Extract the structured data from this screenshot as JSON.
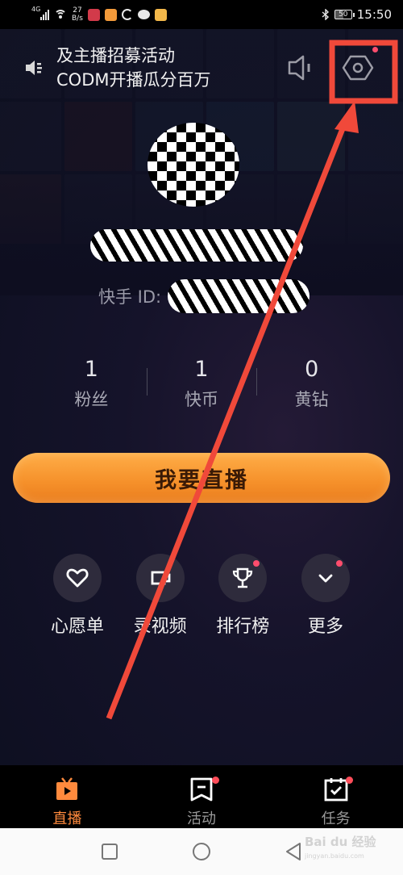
{
  "status_bar": {
    "network": "4G",
    "speed_value": "27",
    "speed_unit": "B/s",
    "battery": "50",
    "time": "15:50",
    "icons": [
      "signal-icon",
      "wifi-icon",
      "app-notification-icon",
      "app-notification-icon",
      "sync-icon",
      "chat-icon",
      "app-notification-icon",
      "bluetooth-icon",
      "battery-icon"
    ]
  },
  "header": {
    "announcement_line1": "及主播招募活动",
    "announcement_line2": "CODM开播瓜分百万",
    "announcement_icon": "speaker-icon",
    "sound_icon": "sound-toggle-icon",
    "settings_icon": "settings-hexagon-icon"
  },
  "profile": {
    "username": "",
    "id_label": "快手 ID:",
    "id_value": ""
  },
  "stats": [
    {
      "value": "1",
      "label": "粉丝"
    },
    {
      "value": "1",
      "label": "快币"
    },
    {
      "value": "0",
      "label": "黄钻"
    }
  ],
  "golive": {
    "label": "我要直播"
  },
  "actions": [
    {
      "label": "心愿单",
      "icon": "heart-icon",
      "badge": false
    },
    {
      "label": "录视频",
      "icon": "record-video-icon",
      "badge": false
    },
    {
      "label": "排行榜",
      "icon": "trophy-icon",
      "badge": true
    },
    {
      "label": "更多",
      "icon": "chevron-down-icon",
      "badge": true
    }
  ],
  "tabs": [
    {
      "label": "直播",
      "icon": "tv-icon",
      "active": true,
      "badge": false
    },
    {
      "label": "活动",
      "icon": "bookmark-icon",
      "active": false,
      "badge": true
    },
    {
      "label": "任务",
      "icon": "calendar-check-icon",
      "active": false,
      "badge": true
    }
  ],
  "navbar": {
    "watermark_line1": "Bai du 经验",
    "watermark_line2": "jingyan.baidu.com"
  },
  "colors": {
    "accent_orange": "#ff8a3d",
    "annotation_red": "#f0493a",
    "badge_red": "#ff4d6d",
    "background": "#15132a"
  }
}
